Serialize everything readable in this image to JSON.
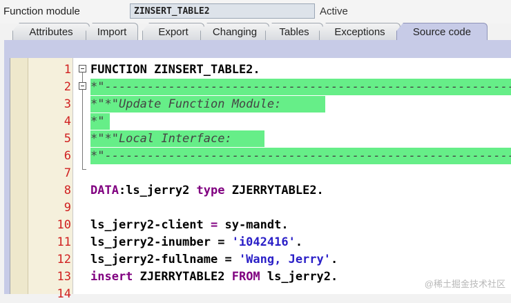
{
  "header": {
    "field_label": "Function module",
    "function_name": "ZINSERT_TABLE2",
    "status": "Active"
  },
  "tabs": [
    {
      "label": "Attributes",
      "active": false
    },
    {
      "label": "Import",
      "active": false
    },
    {
      "label": "Export",
      "active": false
    },
    {
      "label": "Changing",
      "active": false
    },
    {
      "label": "Tables",
      "active": false
    },
    {
      "label": "Exceptions",
      "active": false
    },
    {
      "label": "Source code",
      "active": true
    }
  ],
  "editor": {
    "line_numbers": [
      "1",
      "2",
      "3",
      "4",
      "5",
      "6",
      "7",
      "8",
      "9",
      "10",
      "11",
      "12",
      "13",
      "14"
    ],
    "lines": {
      "l1_kw": "FUNCTION",
      "l1_rest": " ZINSERT_TABLE2.",
      "l2": "*\"----------------------------------------------------------------------",
      "l3": "*\"*\"Update Function Module:",
      "l4": "*\"",
      "l5": "*\"*\"Local Interface:",
      "l6": "*\"----------------------------------------------------------------------",
      "l8_kw1": "DATA",
      "l8_a": ":ls_jerry2 ",
      "l8_kw2": "type",
      "l8_b": " ZJERRYTABLE2.",
      "l10_a": "ls_jerry2-client ",
      "l10_b": "=",
      "l10_c": " sy-mandt.",
      "l11_a": "ls_jerry2-inumber = ",
      "l11_str": "'i042416'",
      "l11_end": ".",
      "l12_a": "ls_jerry2-fullname = ",
      "l12_str": "'Wang, Jerry'",
      "l12_end": ".",
      "l13_kw1": "insert",
      "l13_a": " ZJERRYTABLE2 ",
      "l13_kw2": "FROM",
      "l13_b": " ls_jerry2."
    }
  },
  "watermark": "@稀土掘金技术社区",
  "colors": {
    "comment_bg": "#66ee88",
    "keyword": "#800080",
    "string": "#2a1fc7",
    "line_number": "#d02020",
    "tab_active": "#c7cbe7"
  }
}
